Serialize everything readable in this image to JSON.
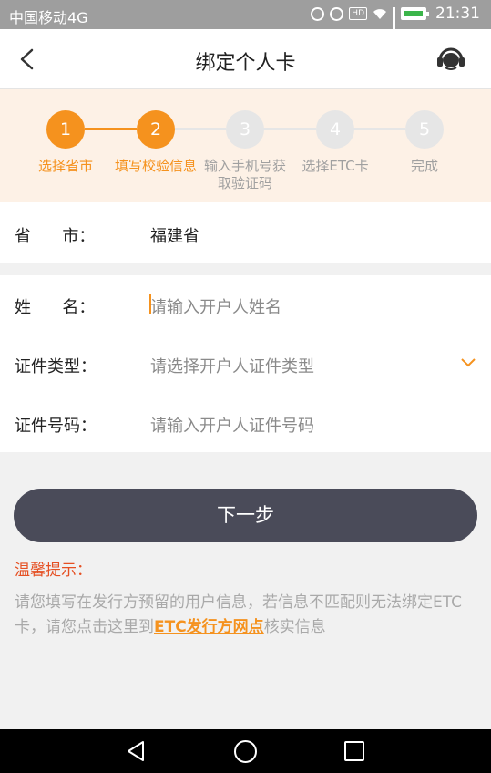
{
  "status_bar": {
    "carrier": "中国移动4G",
    "hd": "HD",
    "time": "21:31"
  },
  "header": {
    "title": "绑定个人卡",
    "back_icon": "chevron-left-icon",
    "service_icon": "headset-icon"
  },
  "steps": [
    {
      "number": "1",
      "label": "选择省市",
      "active": true
    },
    {
      "number": "2",
      "label": "填写校验信息",
      "active": true
    },
    {
      "number": "3",
      "label": "输入手机号获取验证码",
      "active": false
    },
    {
      "number": "4",
      "label": "选择ETC卡",
      "active": false
    },
    {
      "number": "5",
      "label": "完成",
      "active": false
    }
  ],
  "form": {
    "province_label": "省      市：",
    "province_value": "福建省",
    "name_label": "姓      名：",
    "name_placeholder": "请输入开户人姓名",
    "id_type_label": "证件类型：",
    "id_type_placeholder": "请选择开户人证件类型",
    "id_number_label": "证件号码：",
    "id_number_placeholder": "请输入开户人证件号码"
  },
  "next_button": "下一步",
  "tips": {
    "title": "温馨提示：",
    "text_before": "请您填写在发行方预留的用户信息，若信息不匹配则无法绑定ETC卡，请您点击这里到",
    "link": "ETC发行方网点",
    "text_after": "核实信息"
  },
  "colors": {
    "accent": "#f5921e",
    "button": "#4a4b59",
    "tip_title": "#e55023"
  }
}
